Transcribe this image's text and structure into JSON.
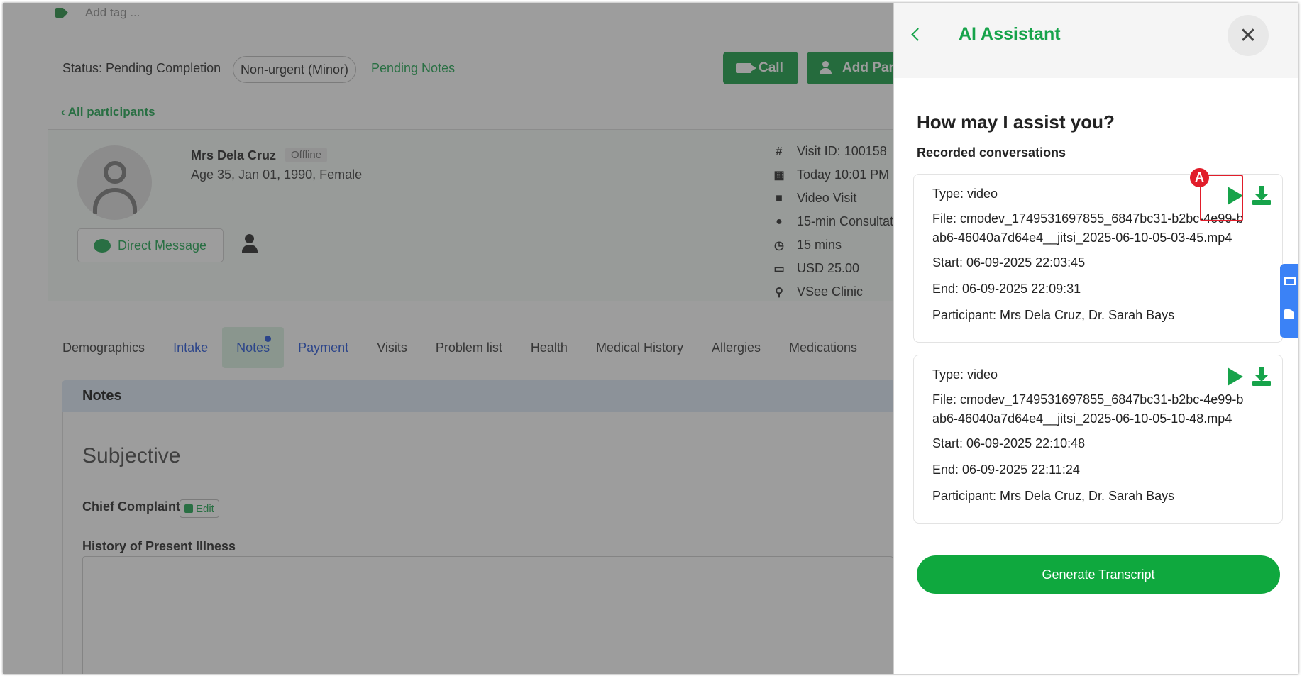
{
  "header": {
    "tag_placeholder": "Add tag ...",
    "status": "Status: Pending Completion",
    "urgency": "Non-urgent (Minor)",
    "pending_notes": "Pending Notes",
    "call_label": "Call",
    "add_participant_label": "Add Part"
  },
  "patient": {
    "back_link": "All participants",
    "name": "Mrs Dela Cruz",
    "presence": "Offline",
    "details": "Age 35, Jan 01, 1990, Female",
    "direct_message": "Direct Message"
  },
  "visit": {
    "visit_id": "Visit ID: 100158",
    "time": "Today 10:01 PM",
    "type": "Video Visit",
    "consult": "15-min Consultat",
    "duration": "15 mins",
    "price": "USD 25.00",
    "location": "VSee Clinic"
  },
  "tabs": [
    "Demographics",
    "Intake",
    "Notes",
    "Payment",
    "Visits",
    "Problem list",
    "Health",
    "Medical History",
    "Allergies",
    "Medications"
  ],
  "notes": {
    "section_title": "Notes",
    "subjective": "Subjective",
    "chief_complaint": "Chief Complaint",
    "edit_label": "Edit",
    "hpi": "History of Present Illness"
  },
  "ai_panel": {
    "title": "AI Assistant",
    "question": "How may I assist you?",
    "recorded_label": "Recorded conversations",
    "marker": "A",
    "recordings": [
      {
        "type": "Type: video",
        "file": "File: cmodev_1749531697855_6847bc31-b2bc-4e99-bab6-46040a7d64e4__jitsi_2025-06-10-05-03-45.mp4",
        "start": "Start: 06-09-2025 22:03:45",
        "end": "End: 06-09-2025 22:09:31",
        "participants": "Participant: Mrs Dela Cruz, Dr. Sarah Bays"
      },
      {
        "type": "Type: video",
        "file": "File: cmodev_1749531697855_6847bc31-b2bc-4e99-bab6-46040a7d64e4__jitsi_2025-06-10-05-10-48.mp4",
        "start": "Start: 06-09-2025 22:10:48",
        "end": "End: 06-09-2025 22:11:24",
        "participants": "Participant: Mrs Dela Cruz, Dr. Sarah Bays"
      }
    ],
    "generate_label": "Generate Transcript"
  },
  "colors": {
    "brand_green": "#16a34a",
    "button_green": "#0fa83e",
    "highlight_red": "#e11d2a",
    "link_blue": "#1d4ed8"
  }
}
